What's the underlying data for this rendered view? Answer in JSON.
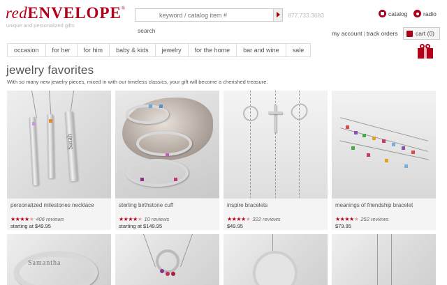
{
  "header": {
    "logo_part1": "red",
    "logo_part2": "ENVELOPE",
    "logo_mark": "®",
    "tagline": "unique and personalized gifts",
    "search": {
      "placeholder": "keyword / catalog item #",
      "label": "search"
    },
    "phone": "877.733.3683",
    "links": {
      "catalog": "catalog",
      "radio": "radio"
    },
    "account": {
      "my_account": "my account",
      "separator": "|",
      "track_orders": "track orders"
    },
    "cart": "cart (0)"
  },
  "nav": {
    "items": [
      "occasion",
      "for her",
      "for him",
      "baby & kids",
      "jewelry",
      "for the home",
      "bar and wine",
      "sale"
    ]
  },
  "page": {
    "title": "jewelry favorites",
    "subtitle": "With so many new jewelry pieces, mixed in with our timeless classics, your gift will become a cherished treasure."
  },
  "products": [
    {
      "name": "personalized milestones necklace",
      "rating": 4,
      "reviews": "406 reviews",
      "price": "starting at $49.95"
    },
    {
      "name": "sterling birthstone cuff",
      "rating": 4,
      "reviews": "10 reviews",
      "price": "starting at $149.95"
    },
    {
      "name": "inspire bracelets",
      "rating": 4.5,
      "reviews": "322 reviews",
      "price": "$49.95"
    },
    {
      "name": "meanings of friendship bracelet",
      "rating": 4,
      "reviews": "252 reviews",
      "price": "$79.95"
    }
  ],
  "engraving": {
    "necklace": "Sarah",
    "ring": "Samantha"
  },
  "colors": {
    "brand": "#b0001b",
    "star": "#b5001b",
    "text": "#444444",
    "muted": "#bbbbbb"
  },
  "icons": [
    "search-arrow-icon",
    "catalog-icon",
    "radio-icon",
    "cart-icon",
    "gift-box-icon",
    "star-icon"
  ]
}
